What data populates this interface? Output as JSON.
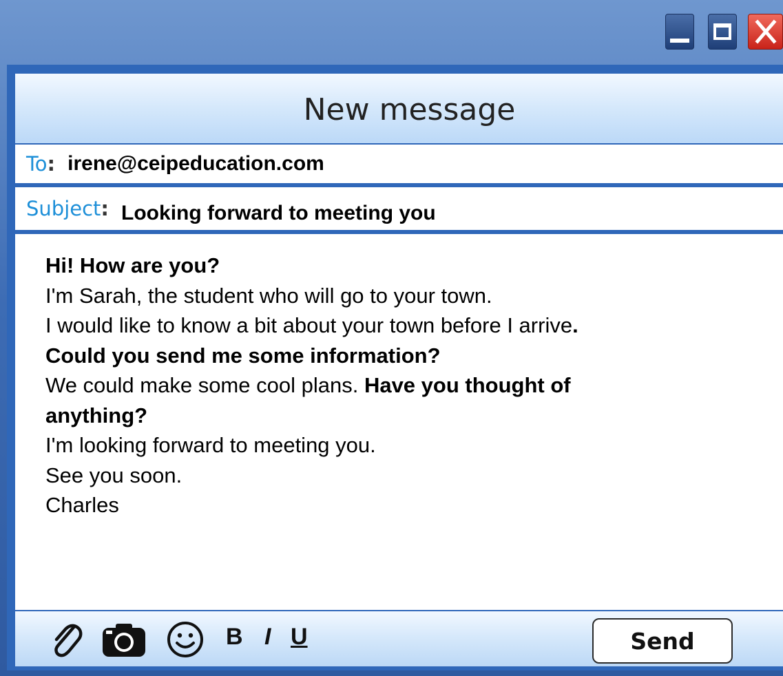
{
  "window": {
    "title": "New message",
    "controls": {
      "minimize": "minimize-icon",
      "maximize": "maximize-icon",
      "close": "close-icon"
    }
  },
  "fields": {
    "to_label": "To",
    "to_value": "irene@ceipeducation.com",
    "subject_label": "Subject",
    "subject_value": "Looking forward to meeting you"
  },
  "body": {
    "line1": "Hi! How are you?",
    "line2": "I'm Sarah, the student who will go to your town.",
    "line3_a": "I would like to know a bit about your town before I arrive",
    "line3_b": ".",
    "line4": "Could you send me some information?",
    "line5_a": "We could make some cool plans. ",
    "line5_b": "Have you thought of",
    "line6": "anything?",
    "line7": "I'm looking forward to meeting you.",
    "line8": "See you soon.",
    "line9": "Charles"
  },
  "toolbar": {
    "icons": [
      "paperclip-icon",
      "camera-icon",
      "smiley-icon"
    ],
    "bold_label": "B",
    "italic_label": "I",
    "underline_label": "U",
    "send_label": "Send"
  },
  "colors": {
    "frame": "#2f67b9",
    "label": "#1d8fd8",
    "close": "#d6392c"
  }
}
